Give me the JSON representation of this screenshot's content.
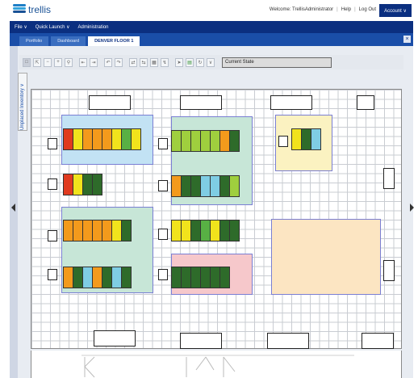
{
  "app": {
    "name": "trellis"
  },
  "topbar": {
    "welcome": "Welcome: TrellisAdministrator",
    "help": "Help",
    "separator": "|",
    "logout": "Log Out",
    "account": "Account ∨"
  },
  "menu": [
    {
      "label": "File ∨"
    },
    {
      "label": "Quick Launch ∨"
    },
    {
      "label": "Administration"
    }
  ],
  "tabs": [
    {
      "label": "Portfolio"
    },
    {
      "label": "Dashboard"
    },
    {
      "label": "DENVER FLOOR 1",
      "active": true
    }
  ],
  "close_label": "×",
  "sidebar_tab": {
    "label": "Unplaced Inventory ∨"
  },
  "toolbar": {
    "state_label": "Current State"
  },
  "colors": {
    "red": "#e03a1e",
    "yellow": "#f1e31c",
    "orange": "#f39a1c",
    "lime": "#9fcf3e",
    "green": "#58b044",
    "darkgreen": "#2e6b2a",
    "cyan": "#7fcde4",
    "zone_blue": "#c2e2f4",
    "zone_green": "#c7e6d7",
    "zone_yellow": "#fbf2c1",
    "zone_pink": "#f6c8cb",
    "zone_peach": "#fce5c2"
  },
  "rack_rows": [
    {
      "name": "row-1",
      "colors": [
        "red",
        "yellow",
        "orange",
        "orange",
        "orange",
        "yellow",
        "green",
        "yellow"
      ]
    },
    {
      "name": "row-2",
      "colors": [
        "red",
        "yellow",
        "darkgreen",
        "darkgreen"
      ]
    },
    {
      "name": "row-3",
      "colors": [
        "orange",
        "orange",
        "orange",
        "orange",
        "orange",
        "yellow",
        "darkgreen"
      ]
    },
    {
      "name": "row-4",
      "colors": [
        "orange",
        "darkgreen",
        "cyan",
        "orange",
        "darkgreen",
        "cyan",
        "darkgreen"
      ]
    },
    {
      "name": "row-5",
      "colors": [
        "lime",
        "lime",
        "lime",
        "lime",
        "lime",
        "orange",
        "darkgreen"
      ]
    },
    {
      "name": "row-6",
      "colors": [
        "orange",
        "darkgreen",
        "darkgreen",
        "cyan",
        "cyan",
        "darkgreen",
        "lime"
      ]
    },
    {
      "name": "row-7",
      "colors": [
        "yellow",
        "yellow",
        "darkgreen",
        "green",
        "yellow",
        "darkgreen",
        "darkgreen"
      ]
    },
    {
      "name": "row-8",
      "colors": [
        "darkgreen",
        "darkgreen",
        "darkgreen",
        "darkgreen",
        "darkgreen",
        "darkgreen"
      ]
    },
    {
      "name": "row-9",
      "colors": [
        "yellow",
        "darkgreen",
        "cyan"
      ]
    }
  ]
}
